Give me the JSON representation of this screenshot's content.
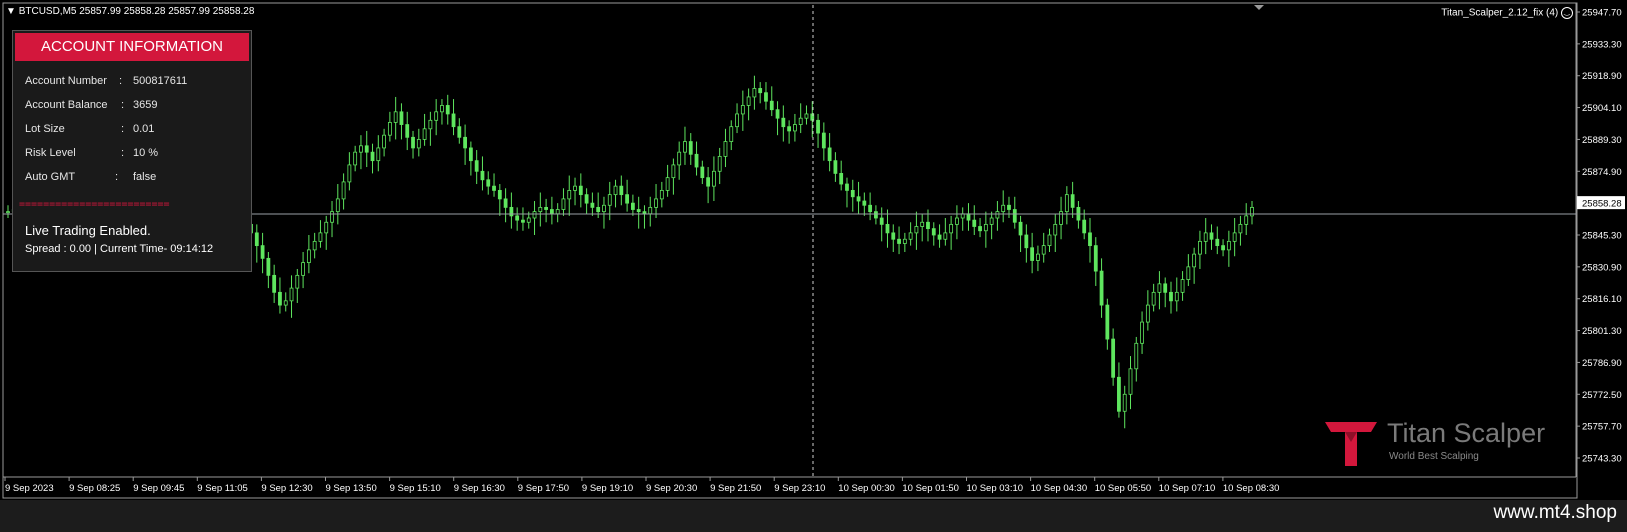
{
  "symbol": {
    "label": "BTCUSD,M5  25857.99 25858.28 25857.99 25858.28"
  },
  "expert": {
    "label": "Titan_Scalper_2.12_fix (4)",
    "smiley_icon": "smiley-icon"
  },
  "account_panel": {
    "title": "ACCOUNT INFORMATION",
    "rows": [
      {
        "label": "Account Number",
        "sep": ":",
        "value": "500817611"
      },
      {
        "label": "Account Balance",
        "sep": ":",
        "value": "3659"
      },
      {
        "label": "Lot Size",
        "sep": ":",
        "value": "0.01"
      },
      {
        "label": "Risk Level",
        "sep": ":",
        "value": "10 %"
      },
      {
        "label": "Auto GMT",
        "sep": ":",
        "value": "false"
      }
    ],
    "divider": "=========================",
    "status": "Live Trading Enabled.",
    "spread_line": "Spread : 0.00  |  Current Time- 09:14:12",
    "title_color": "#d3173c"
  },
  "price_axis": {
    "ticks": [
      "25947.70",
      "25933.30",
      "25918.90",
      "25904.10",
      "25889.30",
      "25874.90",
      "25858.28",
      "25845.30",
      "25830.90",
      "25816.10",
      "25801.30",
      "25786.90",
      "25772.50",
      "25757.70",
      "25743.30"
    ],
    "current_price": "25858.28"
  },
  "time_axis": {
    "ticks": [
      "9 Sep 2023",
      "9 Sep 08:25",
      "9 Sep 09:45",
      "9 Sep 11:05",
      "9 Sep 12:30",
      "9 Sep 13:50",
      "9 Sep 15:10",
      "9 Sep 16:30",
      "9 Sep 17:50",
      "9 Sep 19:10",
      "9 Sep 20:30",
      "9 Sep 21:50",
      "9 Sep 23:10",
      "10 Sep 00:30",
      "10 Sep 01:50",
      "10 Sep 03:10",
      "10 Sep 04:30",
      "10 Sep 05:50",
      "10 Sep 07:10",
      "10 Sep 08:30"
    ]
  },
  "logo": {
    "name": "Titan Scalper",
    "tagline": "World Best Scalping"
  },
  "watermark": "www.mt4.shop",
  "colors": {
    "candles": "#5fe65f",
    "background": "#000000",
    "accent": "#d3173c"
  },
  "chart_data": {
    "type": "candlestick",
    "xlabel": "",
    "ylabel": "",
    "ylim": [
      25740,
      25950
    ],
    "close_series": [
      25856,
      25857,
      25858,
      25862,
      25866,
      25870,
      25874,
      25878,
      25883,
      25887,
      25890,
      25885,
      25880,
      25876,
      25873,
      25870,
      25866,
      25863,
      25860,
      25856,
      25853,
      25850,
      25852,
      25855,
      25854,
      25852,
      25850,
      25852,
      25855,
      25857,
      25856,
      25854,
      25853,
      25855,
      25857,
      25854,
      25852,
      25850,
      25852,
      25855,
      25853,
      25850,
      25846,
      25840,
      25834,
      25826,
      25818,
      25812,
      25814,
      25820,
      25826,
      25832,
      25838,
      25842,
      25846,
      25851,
      25856,
      25862,
      25870,
      25878,
      25884,
      25887,
      25884,
      25880,
      25886,
      25892,
      25898,
      25903,
      25897,
      25891,
      25886,
      25890,
      25895,
      25899,
      25903,
      25906,
      25902,
      25896,
      25891,
      25886,
      25880,
      25875,
      25871,
      25868,
      25866,
      25862,
      25858,
      25854,
      25852,
      25851,
      25853,
      25856,
      25858,
      25857,
      25855,
      25857,
      25862,
      25866,
      25868,
      25864,
      25860,
      25858,
      25856,
      25859,
      25864,
      25868,
      25864,
      25860,
      25857,
      25856,
      25855,
      25858,
      25862,
      25866,
      25872,
      25878,
      25884,
      25889,
      25883,
      25877,
      25872,
      25868,
      25875,
      25882,
      25889,
      25896,
      25902,
      25906,
      25910,
      25914,
      25912,
      25908,
      25904,
      25900,
      25896,
      25894,
      25897,
      25900,
      25902,
      25899,
      25893,
      25886,
      25880,
      25874,
      25869,
      25866,
      25863,
      25861,
      25859,
      25856,
      25853,
      25850,
      25846,
      25843,
      25841,
      25843,
      25846,
      25849,
      25851,
      25848,
      25845,
      25843,
      25846,
      25850,
      25853,
      25855,
      25852,
      25849,
      25847,
      25850,
      25853,
      25856,
      25859,
      25857,
      25851,
      25845,
      25839,
      25833,
      25836,
      25840,
      25845,
      25850,
      25856,
      25864,
      25858,
      25852,
      25846,
      25840,
      25828,
      25812,
      25796,
      25778,
      25762,
      25770,
      25782,
      25794,
      25804,
      25812,
      25818,
      25822,
      25818,
      25814,
      25818,
      25824,
      25830,
      25836,
      25842,
      25846,
      25843,
      25840,
      25838,
      25842,
      25846,
      25850,
      25854,
      25858
    ]
  }
}
